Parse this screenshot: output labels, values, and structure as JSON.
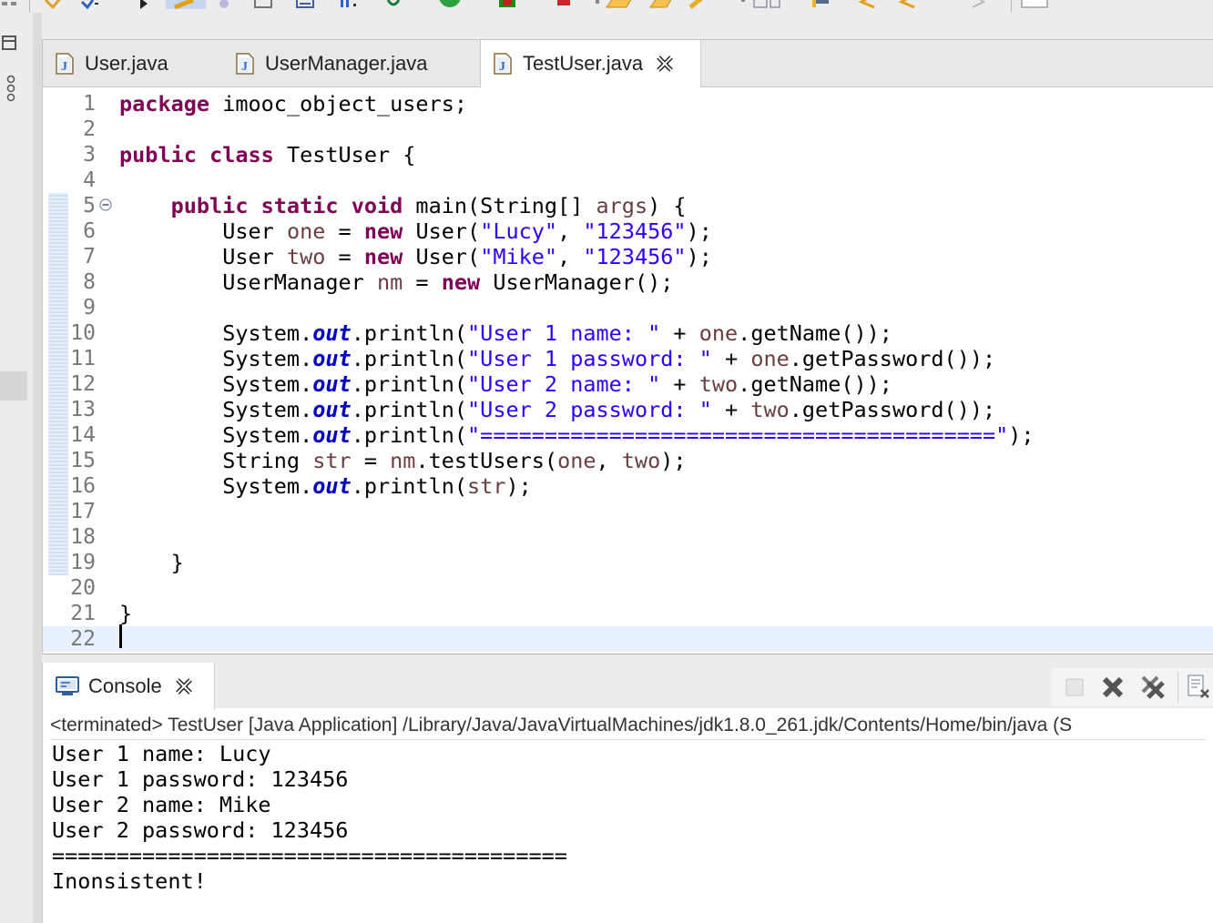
{
  "editor": {
    "tabs": [
      {
        "label": "User.java",
        "active": false
      },
      {
        "label": "UserManager.java",
        "active": false
      },
      {
        "label": "TestUser.java",
        "active": true
      }
    ],
    "line_numbers": [
      "1",
      "2",
      "3",
      "4",
      "5",
      "6",
      "7",
      "8",
      "9",
      "10",
      "11",
      "12",
      "13",
      "14",
      "15",
      "16",
      "17",
      "18",
      "19",
      "20",
      "21",
      "22"
    ],
    "code": {
      "l1_kw": "package",
      "l1_rest": " imooc_object_users;",
      "l3_kw1": "public",
      "l3_kw2": "class",
      "l3_rest": " TestUser {",
      "l5_kw1": "public",
      "l5_kw2": "static",
      "l5_kw3": "void",
      "l5_rest1": " main(String[] ",
      "l5_var": "args",
      "l5_rest2": ") {",
      "l6_a": "User ",
      "l6_var": "one",
      "l6_b": " = ",
      "l6_kw": "new",
      "l6_c": " User(",
      "l6_s1": "\"Lucy\"",
      "l6_d": ", ",
      "l6_s2": "\"123456\"",
      "l6_e": ");",
      "l7_a": "User ",
      "l7_var": "two",
      "l7_b": " = ",
      "l7_kw": "new",
      "l7_c": " User(",
      "l7_s1": "\"Mike\"",
      "l7_d": ", ",
      "l7_s2": "\"123456\"",
      "l7_e": ");",
      "l8_a": "UserManager ",
      "l8_var": "nm",
      "l8_b": " = ",
      "l8_kw": "new",
      "l8_c": " UserManager();",
      "sys": "System.",
      "out": "out",
      "println": ".println(",
      "l10_str": "\"User 1 name: \"",
      "plus": " + ",
      "l10_var": "one",
      "l10_end": ".getName());",
      "l11_str": "\"User 1 password: \"",
      "l11_var": "one",
      "l11_end": ".getPassword());",
      "l12_str": "\"User 2 name: \"",
      "l12_var": "two",
      "l12_end": ".getName());",
      "l13_str": "\"User 2 password: \"",
      "l13_var": "two",
      "l13_end": ".getPassword());",
      "l14_str": "\"========================================\"",
      "l14_end": ");",
      "l15_a": "String ",
      "l15_var1": "str",
      "l15_b": " = ",
      "l15_var2": "nm",
      "l15_c": ".testUsers(",
      "l15_var3": "one",
      "l15_d": ", ",
      "l15_var4": "two",
      "l15_e": ");",
      "l16_var": "str",
      "l16_end": ");",
      "l19": "}",
      "l21": "}"
    }
  },
  "console": {
    "tab_label": "Console",
    "status": "<terminated> TestUser [Java Application] /Library/Java/JavaVirtualMachines/jdk1.8.0_261.jdk/Contents/Home/bin/java  (S",
    "output": [
      "User 1 name: Lucy",
      "User 1 password: 123456",
      "User 2 name: Mike",
      "User 2 password: 123456",
      "========================================",
      "Inonsistent!"
    ]
  },
  "colors": {
    "keyword": "#7f0055",
    "string": "#2a00ff",
    "static_field": "#0000c0",
    "local_variable": "#6a3e3e",
    "current_line": "#e8f2fe"
  }
}
